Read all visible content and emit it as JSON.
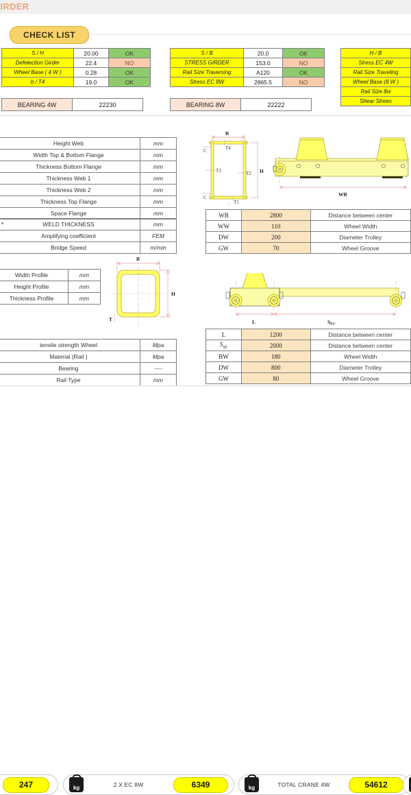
{
  "document": {
    "title": "GIRDER",
    "checklist_label": "CHECK LIST"
  },
  "check_tables": {
    "left": {
      "rows": [
        {
          "label": "S / H",
          "value": "20.00",
          "status": "OK"
        },
        {
          "label": "Defelection Girder",
          "value": "22.4",
          "status": "NO"
        },
        {
          "label": "Wheel Base ( 4 W )",
          "value": "0.28",
          "status": "OK"
        },
        {
          "label": "b / T4",
          "value": "19.0",
          "status": "OK"
        }
      ],
      "bearing": {
        "label": "BEARING 4W",
        "value": "22230"
      }
    },
    "middle": {
      "rows": [
        {
          "label": "S / B",
          "value": "20.0",
          "status": "OK"
        },
        {
          "label": "STRESS GIRDER",
          "value": "153.0",
          "status": "NO"
        },
        {
          "label": "Rail Size Traversing",
          "value": "A120",
          "status": "OK"
        },
        {
          "label": "Stress EC   8W",
          "value": "2865.5",
          "status": "NO"
        }
      ],
      "bearing": {
        "label": "BEARING 8W",
        "value": "22222"
      }
    },
    "right": {
      "rows": [
        {
          "label": "H / B"
        },
        {
          "label": "Stress EC   4W"
        },
        {
          "label": "Rail Size Traveling"
        },
        {
          "label": "Wheel Base (8 W )"
        },
        {
          "label": "Rail Size 8w"
        },
        {
          "label": "Shear Strees"
        }
      ]
    }
  },
  "param_tables": {
    "girder": [
      {
        "name": "Height Web",
        "unit": "mm"
      },
      {
        "name": "Width Top & Bottom  Flange",
        "unit": "mm"
      },
      {
        "name": "Thickness Bottom Flange",
        "unit": "mm"
      },
      {
        "name": "Thickness Web 1",
        "unit": "mm"
      },
      {
        "name": "Thickness Web 2",
        "unit": "mm"
      },
      {
        "name": "Thickness Top Flange",
        "unit": "mm"
      },
      {
        "name": "Space Flange",
        "unit": "mm"
      }
    ],
    "weld": [
      {
        "name": "WELD THICKNESS",
        "unit": "mm"
      },
      {
        "name": "Amplifying coefficient",
        "unit": "FEM"
      },
      {
        "name": "Bridge Speed",
        "unit": "m/min"
      }
    ],
    "profile": [
      {
        "name": "Width Profile",
        "unit": "mm"
      },
      {
        "name": "Height Profile",
        "unit": "mm"
      },
      {
        "name": "Thickness Profile",
        "unit": "mm"
      }
    ],
    "wheel": [
      {
        "name": "tensile strength Wheel",
        "unit": "Mpa"
      },
      {
        "name": "Material (Rail )",
        "unit": "Mpa"
      },
      {
        "name": "Bearing",
        "unit": "----"
      },
      {
        "name": "Rail Type",
        "unit": "mm"
      }
    ]
  },
  "data_tables": {
    "trolley": [
      {
        "key": "WB",
        "value": "2800",
        "desc": "Distance between center"
      },
      {
        "key": "WW",
        "value": "110",
        "desc": "Wheel Width"
      },
      {
        "key": "DW",
        "value": "200",
        "desc": "Diameter Trolley"
      },
      {
        "key": "GW",
        "value": "70",
        "desc": "Wheel Groove"
      }
    ],
    "carriage": [
      {
        "key": "L",
        "value": "1200",
        "desc": "Distance between center"
      },
      {
        "key": "S_SE",
        "value": "2000",
        "desc": "Distance between center"
      },
      {
        "key": "BW",
        "value": "180",
        "desc": "Wheel Width"
      },
      {
        "key": "DW",
        "value": "800",
        "desc": "Diameter Trolley"
      },
      {
        "key": "GW",
        "value": "80",
        "desc": "Wheel Groove"
      }
    ]
  },
  "drawings": {
    "section": {
      "dims": [
        "B",
        "H",
        "T1",
        "T2",
        "T3",
        "T4",
        "C",
        "C"
      ]
    },
    "trolley": {
      "dims": [
        "WB"
      ]
    },
    "profile": {
      "dims": [
        "B",
        "H",
        "T"
      ]
    },
    "carriage": {
      "dims": [
        "L",
        "S_EC"
      ]
    }
  },
  "statusbar": {
    "groups": [
      {
        "value": "247",
        "label": "",
        "icon": ""
      },
      {
        "value": "6349",
        "label": "2 X EC 8W",
        "icon": "kg-weight-icon"
      },
      {
        "value": "54612",
        "label": "TOTAL CRANE 4W",
        "icon": "kg-weight-icon"
      }
    ],
    "trailing_icon": "kg-weight-icon"
  },
  "colors": {
    "label_yellow": "#ffff00",
    "status_ok": "#8ecb6d",
    "status_no": "#f8cbad",
    "bearing_label": "#fce4d6",
    "data_value": "#fbe5c0",
    "pill": "#f7d36a",
    "title": "#e8a57c"
  }
}
